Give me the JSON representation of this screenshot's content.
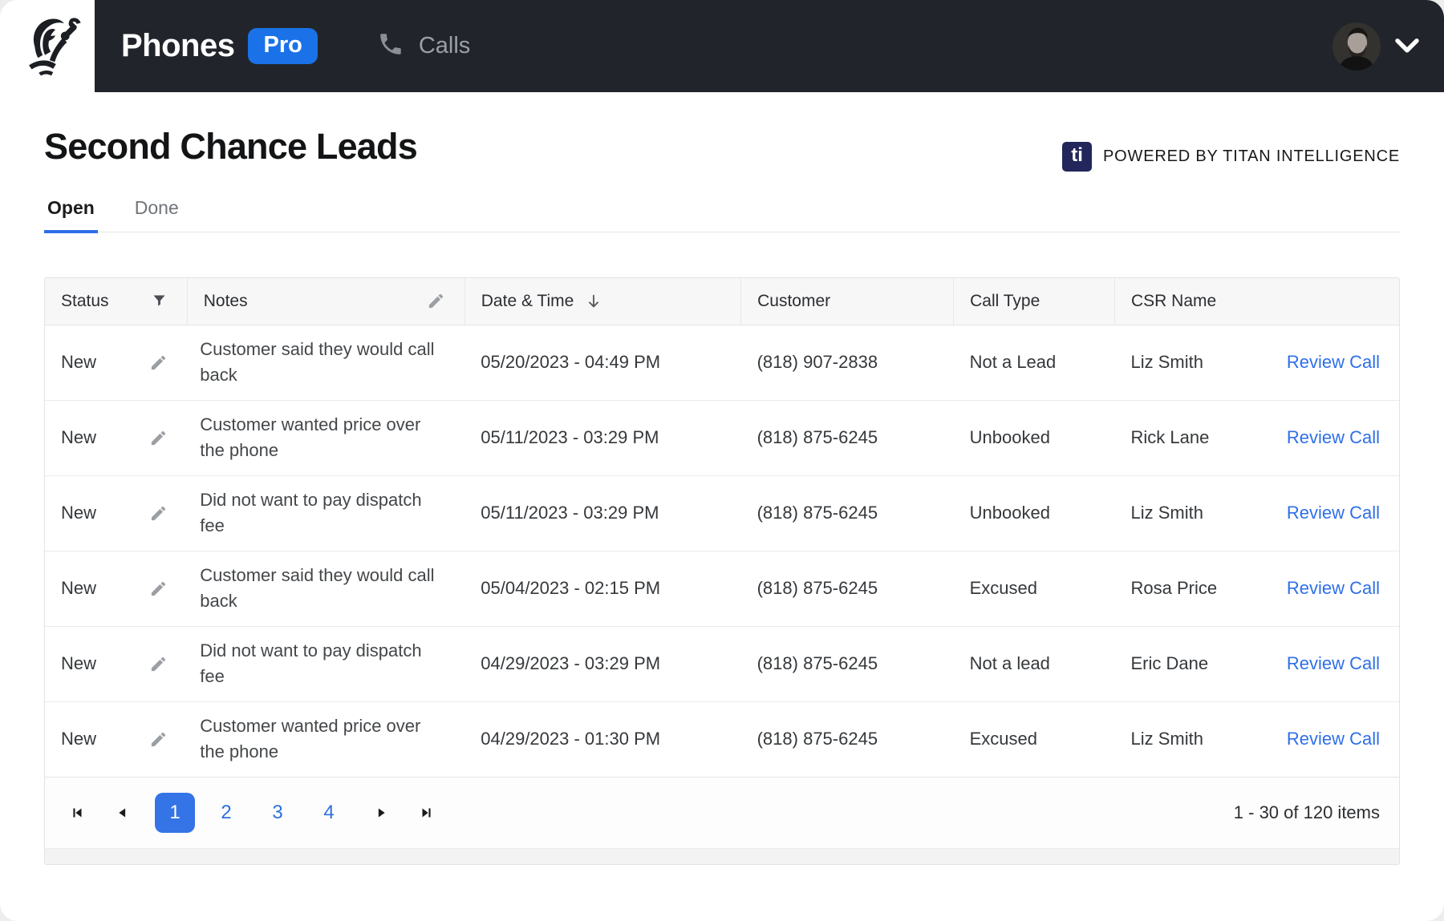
{
  "topbar": {
    "app_name": "Phones",
    "pro_badge": "Pro",
    "nav_calls": "Calls"
  },
  "page": {
    "title": "Second Chance Leads",
    "powered_by": {
      "badge": "ti",
      "label": "POWERED BY TITAN INTELLIGENCE"
    },
    "tabs": [
      {
        "label": "Open",
        "active": true
      },
      {
        "label": "Done",
        "active": false
      }
    ]
  },
  "table": {
    "columns": [
      "Status",
      "Notes",
      "Date & Time",
      "Customer",
      "Call Type",
      "CSR Name"
    ],
    "rows": [
      {
        "status": "New",
        "notes": "Customer said they would call back",
        "datetime": "05/20/2023 - 04:49 PM",
        "customer": "(818) 907-2838",
        "call_type": "Not a Lead",
        "csr_name": "Liz Smith",
        "action": "Review Call"
      },
      {
        "status": "New",
        "notes": "Customer wanted price over the phone",
        "datetime": "05/11/2023 - 03:29 PM",
        "customer": "(818) 875-6245",
        "call_type": "Unbooked",
        "csr_name": "Rick Lane",
        "action": "Review Call"
      },
      {
        "status": "New",
        "notes": "Did not want to pay dispatch fee",
        "datetime": "05/11/2023 - 03:29 PM",
        "customer": "(818) 875-6245",
        "call_type": "Unbooked",
        "csr_name": "Liz Smith",
        "action": "Review Call"
      },
      {
        "status": "New",
        "notes": "Customer said they would call back",
        "datetime": "05/04/2023 - 02:15 PM",
        "customer": "(818) 875-6245",
        "call_type": "Excused",
        "csr_name": "Rosa Price",
        "action": "Review Call"
      },
      {
        "status": "New",
        "notes": "Did not want to pay dispatch fee",
        "datetime": "04/29/2023 - 03:29 PM",
        "customer": "(818) 875-6245",
        "call_type": "Not a lead",
        "csr_name": "Eric Dane",
        "action": "Review Call"
      },
      {
        "status": "New",
        "notes": "Customer wanted price over the phone",
        "datetime": "04/29/2023 - 01:30 PM",
        "customer": "(818) 875-6245",
        "call_type": "Excused",
        "csr_name": "Liz Smith",
        "action": "Review Call"
      }
    ]
  },
  "pagination": {
    "pages": [
      "1",
      "2",
      "3",
      "4"
    ],
    "active_page": "1",
    "summary": "1 - 30 of 120 items"
  },
  "colors": {
    "topbar_bg": "#21252b",
    "accent_blue": "#1b72e8",
    "link_blue": "#2e6fe8",
    "active_page_blue": "#3474e6",
    "tab_underline": "#2d6fe8",
    "ti_badge_navy": "#23265a",
    "header_row_bg": "#f7f7f8"
  }
}
